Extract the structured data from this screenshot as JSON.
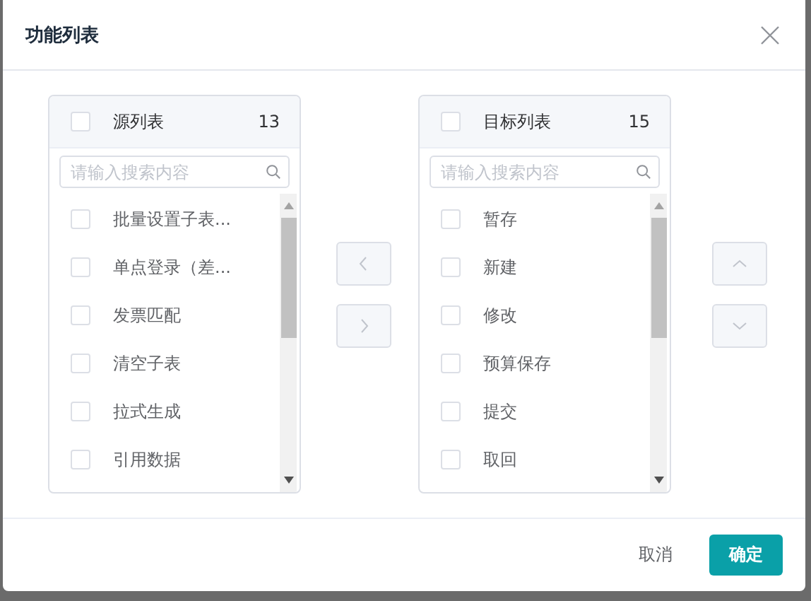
{
  "dialog": {
    "title": "功能列表"
  },
  "source": {
    "title": "源列表",
    "count": "13",
    "checked": false,
    "placeholder": "请输入搜索内容",
    "items": [
      {
        "label": "批量设置子表...",
        "checked": false
      },
      {
        "label": "单点登录（差...",
        "checked": false
      },
      {
        "label": "发票匹配",
        "checked": false
      },
      {
        "label": "清空子表",
        "checked": false
      },
      {
        "label": "拉式生成",
        "checked": false
      },
      {
        "label": "引用数据",
        "checked": false
      }
    ]
  },
  "transfer_buttons": [
    {
      "kind": "left",
      "disabled": true
    },
    {
      "kind": "right",
      "disabled": true
    }
  ],
  "target": {
    "title": "目标列表",
    "count": "15",
    "checked": false,
    "placeholder": "请输入搜索内容",
    "items": [
      {
        "label": "暂存",
        "checked": false
      },
      {
        "label": "新建",
        "checked": false
      },
      {
        "label": "修改",
        "checked": false
      },
      {
        "label": "预算保存",
        "checked": false
      },
      {
        "label": "提交",
        "checked": false
      },
      {
        "label": "取回",
        "checked": false
      }
    ]
  },
  "order_buttons": [
    {
      "kind": "up",
      "disabled": true
    },
    {
      "kind": "down",
      "disabled": true
    }
  ],
  "footer": {
    "cancel": "取消",
    "confirm": "确定"
  }
}
